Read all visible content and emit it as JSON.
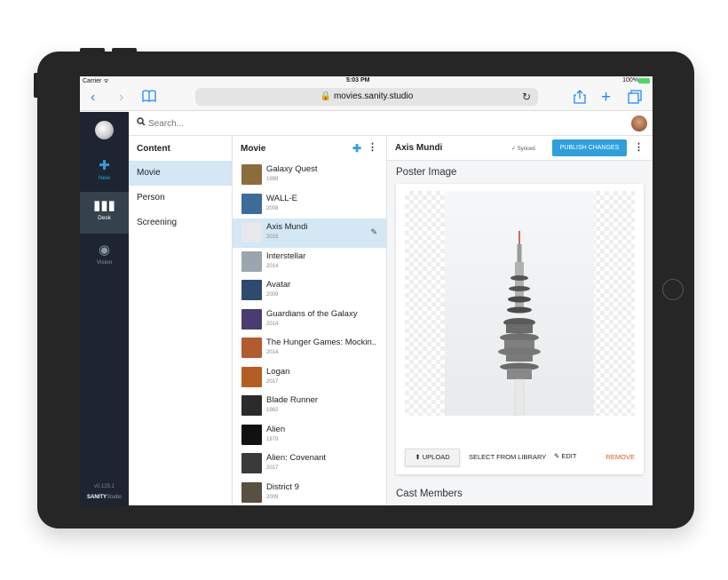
{
  "status": {
    "carrier": "Carrier",
    "time": "5:03 PM",
    "battery": "100%"
  },
  "browser": {
    "url": "movies.sanity.studio"
  },
  "search": {
    "placeholder": "Search..."
  },
  "sidebar": {
    "new_label": "New",
    "desk_label": "Desk",
    "vision_label": "Vision",
    "version": "v0.125.1",
    "brand_bold": "SANITY",
    "brand_rest": "Studio"
  },
  "content_pane": {
    "title": "Content",
    "items": [
      "Movie",
      "Person",
      "Screening"
    ]
  },
  "movie_pane": {
    "title": "Movie",
    "movies": [
      {
        "title": "Galaxy Quest",
        "year": "1999"
      },
      {
        "title": "WALL-E",
        "year": "2008"
      },
      {
        "title": "Axis Mundi",
        "year": "2015"
      },
      {
        "title": "Interstellar",
        "year": "2014"
      },
      {
        "title": "Avatar",
        "year": "2009"
      },
      {
        "title": "Guardians of the Galaxy",
        "year": "2014"
      },
      {
        "title": "The Hunger Games: Mockin...",
        "year": "2014"
      },
      {
        "title": "Logan",
        "year": "2017"
      },
      {
        "title": "Blade Runner",
        "year": "1982"
      },
      {
        "title": "Alien",
        "year": "1979"
      },
      {
        "title": "Alien: Covenant",
        "year": "2017"
      },
      {
        "title": "District 9",
        "year": "2009"
      }
    ]
  },
  "detail": {
    "title": "Axis Mundi",
    "synced": "Synced",
    "publish": "PUBLISH CHANGES",
    "poster_label": "Poster Image",
    "upload": "UPLOAD",
    "select_library": "SELECT FROM LIBRARY",
    "edit": "EDIT",
    "remove": "REMOVE",
    "cast_label": "Cast Members"
  },
  "colors": {
    "accent": "#2fa0dd",
    "sidebar": "#1c2530",
    "selection": "#d3e7f5",
    "danger": "#e2541b"
  }
}
